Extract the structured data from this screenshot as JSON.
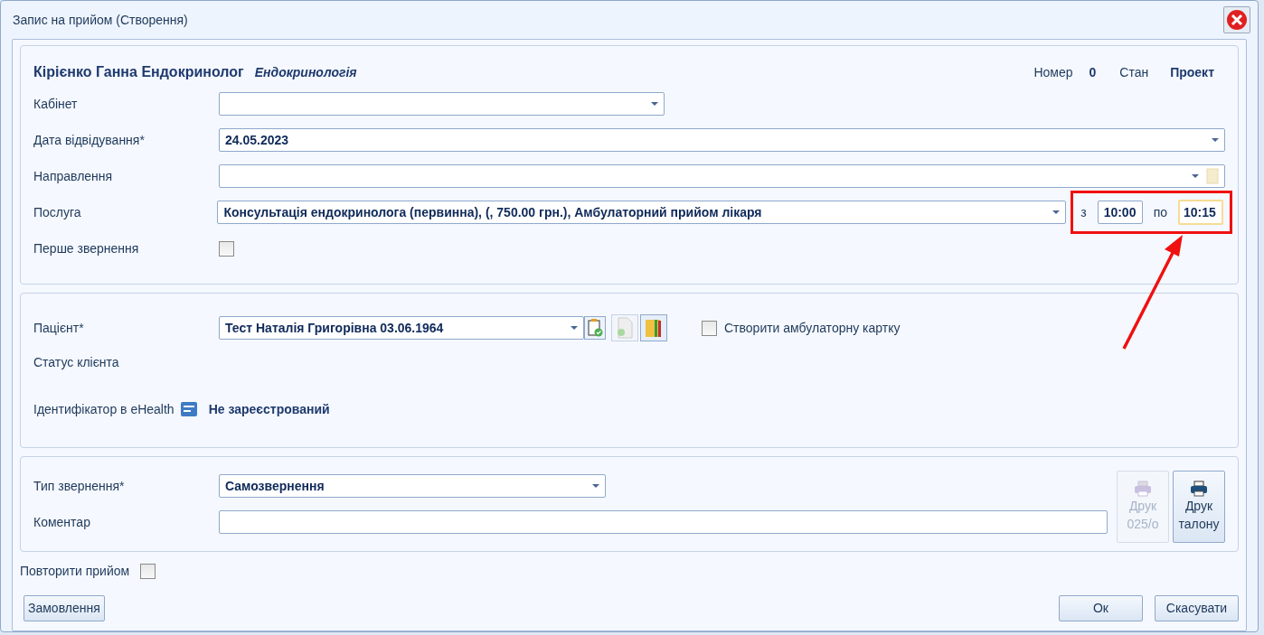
{
  "window": {
    "title": "Запис на прийом (Створення)"
  },
  "header": {
    "doctor": "Кірієнко Ганна Ендокринолог",
    "department": "Ендокринологія",
    "number_label": "Номер",
    "number": "0",
    "state_label": "Стан",
    "state": "Проект"
  },
  "appointment": {
    "cabinet": {
      "label": "Кабінет"
    },
    "date": {
      "label": "Дата відвідування*",
      "value": "24.05.2023"
    },
    "referral": {
      "label": "Направлення"
    },
    "service": {
      "label": "Послуга",
      "value": "Консультація ендокринолога (первинна), (, 750.00 грн.), Амбулаторний прийом лікаря",
      "from_label": "з",
      "from": "10:00",
      "to_label": "по",
      "to": "10:15",
      "to_focused": true,
      "highlighted": true
    },
    "first_visit": {
      "label": "Перше звернення",
      "checked": false
    }
  },
  "patient": {
    "label": "Пацієнт*",
    "value": "Тест Наталія Григорівна 03.06.1964",
    "create_card": {
      "label": "Створити амбулаторну картку",
      "checked": false
    },
    "status_label": "Статус клієнта",
    "ehealth_label": "Ідентифікатор в eHealth",
    "ehealth_value": "Не зареєстрований"
  },
  "visit": {
    "type_label": "Тип звернення*",
    "type_value": "Самозвернення",
    "comment_label": "Коментар",
    "print_buttons": [
      {
        "lines": [
          "Друк",
          "025/о"
        ],
        "disabled": true
      },
      {
        "lines": [
          "Друк",
          "талону"
        ],
        "disabled": false
      }
    ]
  },
  "repeat": {
    "label": "Повторити прийом",
    "checked": false
  },
  "buttons": {
    "order": "Замовлення",
    "ok": "Ок",
    "cancel": "Скасувати"
  }
}
